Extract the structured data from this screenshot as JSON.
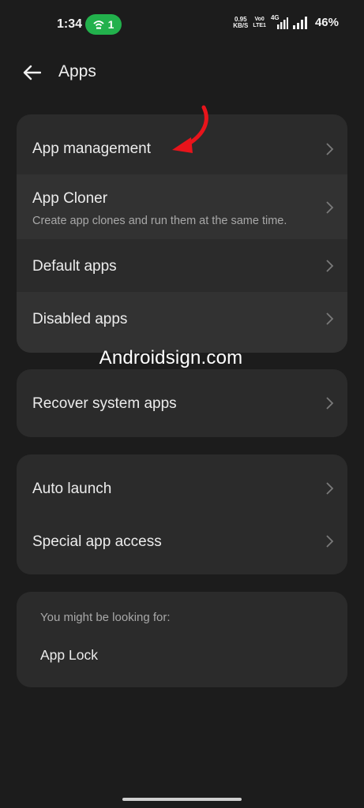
{
  "status_bar": {
    "time": "1:34",
    "hotspot_count": "1",
    "net_speed_value": "0.95",
    "net_speed_unit": "KB/S",
    "volte_line1": "Vo0",
    "volte_line2": "LTE1",
    "network_type": "4G",
    "battery": "46%"
  },
  "header": {
    "title": "Apps"
  },
  "groups": {
    "main": {
      "app_management": "App management",
      "app_cloner": "App Cloner",
      "app_cloner_sub": "Create app clones and run them at the same time.",
      "default_apps": "Default apps",
      "disabled_apps": "Disabled apps"
    },
    "recover": {
      "label": "Recover system apps"
    },
    "launch": {
      "auto_launch": "Auto launch",
      "special_access": "Special app access"
    },
    "suggest": {
      "hint": "You might be looking for:",
      "app_lock": "App Lock"
    }
  },
  "watermark": "Androidsign.com",
  "colors": {
    "background": "#1c1c1c",
    "card": "#2b2b2b",
    "accent_arrow": "#e8141b",
    "hotspot": "#22b14c"
  }
}
